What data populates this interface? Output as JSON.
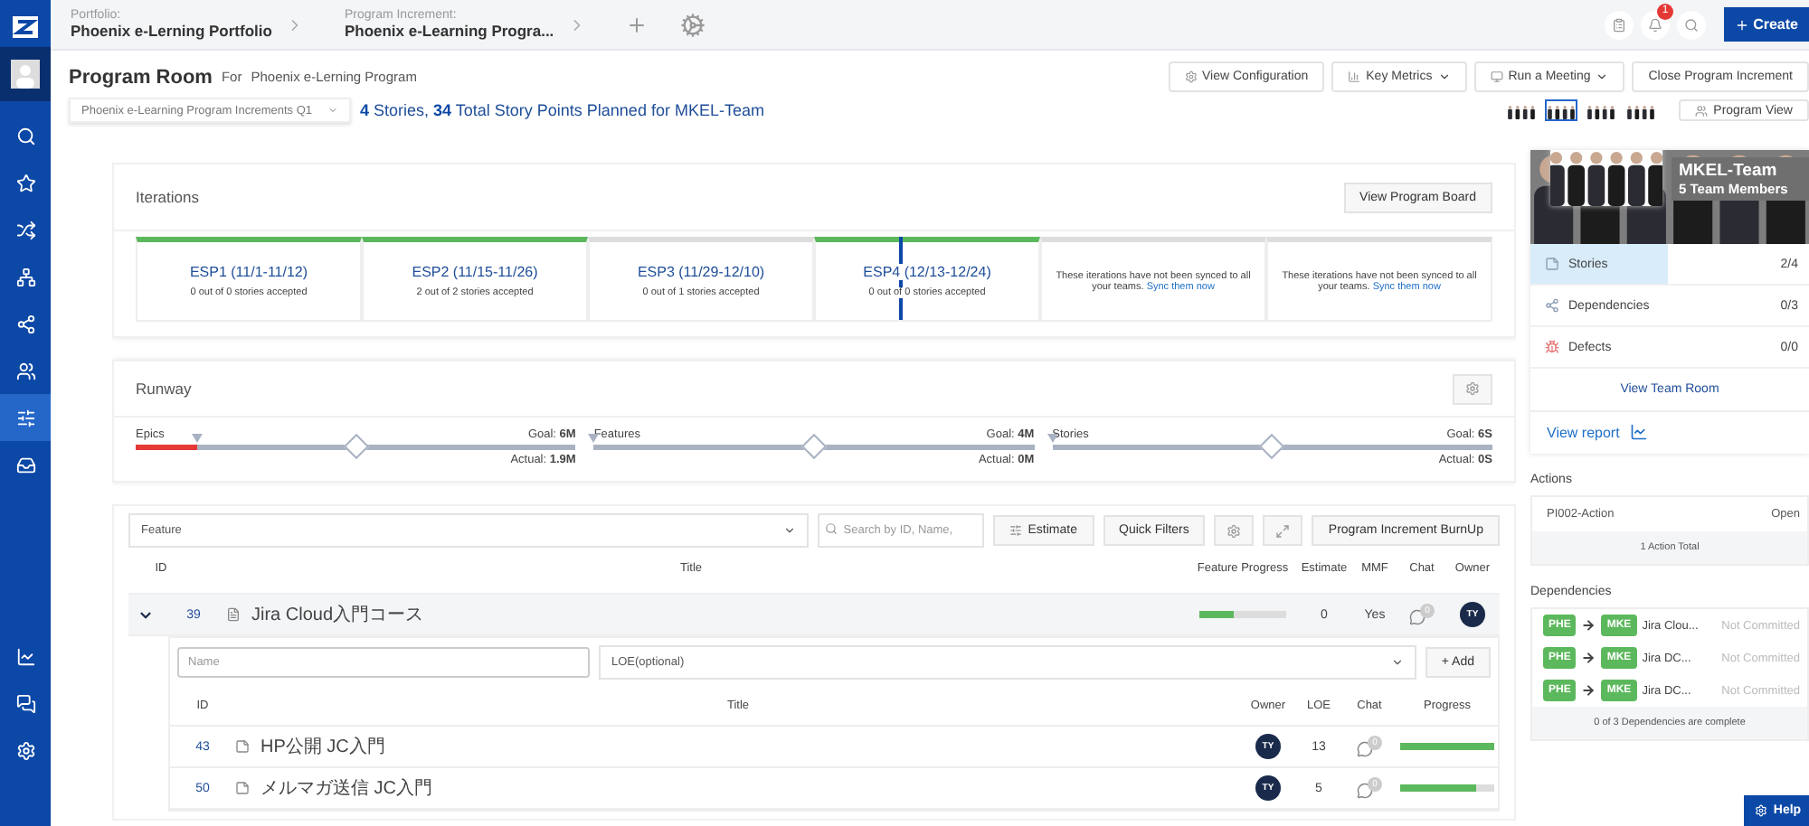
{
  "topbar": {
    "crumbs": [
      {
        "label": "Portfolio:",
        "value": "Phoenix e-Lerning Portfolio"
      },
      {
        "label": "Program Increment:",
        "value": "Phoenix e-Learning Progra..."
      }
    ],
    "notification_count": "1",
    "create_button": "Create"
  },
  "nav": [
    {
      "selected": false
    },
    {
      "selected": false
    },
    {
      "selected": false
    },
    {
      "selected": false
    },
    {
      "selected": false
    },
    {
      "selected": false
    },
    {
      "selected": true
    },
    {
      "selected": false
    }
  ],
  "header": {
    "title": "Program Room",
    "for_label": "For",
    "program": "Phoenix e-Lerning Program",
    "buttons": [
      {
        "label": "View Configuration",
        "dropdown": false
      },
      {
        "label": "Key Metrics",
        "dropdown": true
      },
      {
        "label": "Run a Meeting",
        "dropdown": true
      },
      {
        "label": "Close Program Increment",
        "dropdown": false
      }
    ],
    "increment_select": "Phoenix e-Learning Program Increments Q1",
    "summary": "**4** Stories, **34** Total Story Points Planned for MKEL-Team",
    "team_thumbnails": [
      {
        "kind": "picture",
        "selected": false
      },
      {
        "kind": "picture",
        "selected": true
      },
      {
        "kind": "picture",
        "selected": false
      },
      {
        "kind": "picture",
        "selected": false
      }
    ],
    "view_button": "Program View"
  },
  "iterations": {
    "title": "Iterations",
    "button": "View Program Board",
    "items": [
      {
        "kind": "iteration",
        "name": "ESP1 (11/1-11/12)",
        "note": "0 out of 0 stories accepted",
        "color": "#5cb85c",
        "current": false
      },
      {
        "kind": "iteration",
        "name": "ESP2 (11/15-11/26)",
        "note": "2 out of 2 stories accepted",
        "color": "#5cb85c",
        "current": false
      },
      {
        "kind": "iteration",
        "name": "ESP3 (11/29-12/10)",
        "note": "0 out of 1 stories accepted",
        "color": "#dddddd",
        "current": false
      },
      {
        "kind": "iteration",
        "name": "ESP4 (12/13-12/24)",
        "note": "0 out of 0 stories accepted",
        "color": "#5cb85c",
        "current": true
      },
      {
        "kind": "unsynced",
        "note": "These iterations have not been synced to all your teams.",
        "link": "Sync them now",
        "color": "#dddddd"
      },
      {
        "kind": "unsynced",
        "note": "These iterations have not been synced to all your teams.",
        "link": "Sync them now",
        "color": "#dddddd"
      }
    ]
  },
  "runway": {
    "title": "Runway",
    "items": [
      {
        "label": "Epics",
        "goal": "Goal: **6M**",
        "actual": "Actual: **1.9M**",
        "level": 0.14
      },
      {
        "label": "Features",
        "goal": "Goal: **4M**",
        "actual": "Actual: **0M**",
        "level": 0
      },
      {
        "label": "Stories",
        "goal": "Goal: **6S**",
        "actual": "Actual: **0S**",
        "level": 0
      }
    ]
  },
  "features": {
    "type_select": "Feature",
    "search_placeholder": "Search by ID, Name,",
    "buttons": [
      "Estimate",
      "Quick Filters"
    ],
    "burnup_button": "Program Increment BurnUp",
    "columns": [
      "ID",
      "Title",
      "Feature Progress",
      "Estimate",
      "MMF",
      "Chat",
      "Owner"
    ],
    "rows": [
      {
        "expanded": true,
        "id": "39",
        "title": "Jira Cloud入門コース",
        "level": 0.4,
        "estimate": "0",
        "mmf": "Yes",
        "chat_count": "0",
        "owner": "TY",
        "name_placeholder": "Name",
        "loe_select": "LOE(optional)",
        "add_button": "+ Add",
        "story_columns": [
          "ID",
          "Title",
          "Owner",
          "LOE",
          "Chat",
          "Progress"
        ],
        "stories": [
          {
            "id": "43",
            "title": "HP公開 JC入門",
            "owner": "TY",
            "loe": "13",
            "chat_count": "0",
            "level": 1
          },
          {
            "id": "50",
            "title": "メルマガ送信 JC入門",
            "owner": "TY",
            "loe": "5",
            "chat_count": "0",
            "level": 0.8
          }
        ]
      }
    ]
  },
  "team": {
    "name": "MKEL-Team",
    "members": "5 Team Members",
    "stats": [
      {
        "kind": "stories",
        "label": "Stories",
        "value": "2/4",
        "selected": true
      },
      {
        "kind": "dependencies",
        "label": "Dependencies",
        "value": "0/3",
        "selected": false
      },
      {
        "kind": "defects",
        "label": "Defects",
        "value": "0/0",
        "selected": false
      }
    ],
    "room_link": "View Team Room",
    "report_link": "View report"
  },
  "actions": {
    "title": "Actions",
    "items": [
      {
        "name": "PI002-Action",
        "status": "Open"
      }
    ],
    "total": "1 Action Total"
  },
  "dependencies": {
    "title": "Dependencies",
    "items": [
      {
        "from": "PHE",
        "to": "MKE",
        "name": "Jira Clou...",
        "status": "Not Committed"
      },
      {
        "from": "PHE",
        "to": "MKE",
        "name": "Jira DC...",
        "status": "Not Committed"
      },
      {
        "from": "PHE",
        "to": "MKE",
        "name": "Jira DC...",
        "status": "Not Committed"
      }
    ],
    "total": "0 of 3 Dependencies are complete"
  },
  "help_button": "Help"
}
